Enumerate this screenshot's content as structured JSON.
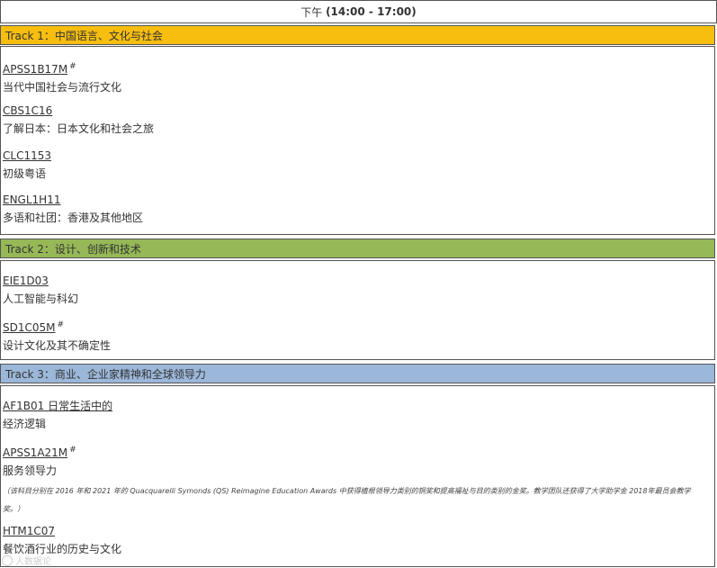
{
  "header": {
    "period": "下午",
    "time": "(14:00 - 17:00)"
  },
  "colors": {
    "track1": "#F7BE10",
    "track2": "#96B857",
    "track3": "#9BB7D9",
    "border": "#555555"
  },
  "tracks": [
    {
      "label": "Track 1：中国语言、文化与社会",
      "courses": [
        {
          "code": "APSS1B17M",
          "mark": "#",
          "title": "当代中国社会与流行文化"
        },
        {
          "code": "CBS1C16",
          "mark": "",
          "title": "了解日本：日本文化和社会之旅"
        },
        {
          "code": "CLC1153",
          "mark": "",
          "title": "初级粤语"
        },
        {
          "code": "ENGL1H11",
          "mark": "",
          "title": "多语和社团：香港及其他地区"
        }
      ]
    },
    {
      "label": "Track 2：设计、创新和技术",
      "courses": [
        {
          "code": "EIE1D03",
          "mark": "",
          "title": "人工智能与科幻"
        },
        {
          "code": "SD1C05M",
          "mark": "#",
          "title": "设计文化及其不确定性"
        }
      ]
    },
    {
      "label": "Track 3：商业、企业家精神和全球领导力",
      "courses": [
        {
          "code": "AF1B01 日常生活中的",
          "mark": "",
          "title": "经济逻辑"
        },
        {
          "code": "APSS1A21M",
          "mark": "#",
          "title": "服务领导力",
          "note": "（该科目分别在 2016 年和 2021 年的 Quacquarelli Symonds (QS) Reimagine Education Awards 中获得植根领导力类别的铜奖和提高福祉与目的类别的金奖。教学团队还获得了大学助学金 2018年最员会教学奖。）"
        },
        {
          "code": "HTM1C07",
          "mark": "",
          "title": "餐饮酒行业的历史与文化"
        }
      ]
    }
  ],
  "watermark": {
    "text": "人数据论"
  }
}
